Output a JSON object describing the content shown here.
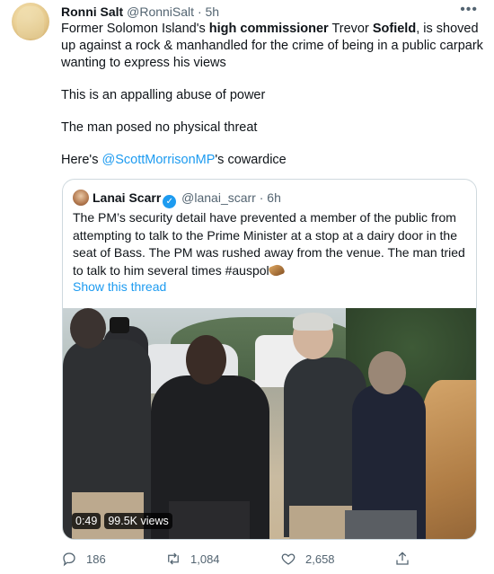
{
  "tweet": {
    "author_name": "Ronni Salt",
    "author_handle": "@RonniSalt",
    "separator": "·",
    "time": "5h",
    "more_label": "•••",
    "body": {
      "p1_a": "Former Solomon Island's ",
      "p1_b": "high commissioner",
      "p1_c": " Trevor ",
      "p1_d": "Sofield",
      "p1_e": ", is shoved up against a rock & manhandled for the crime of being in a public carpark wanting to express his views",
      "p2": "This is an appalling abuse of power",
      "p3": "The man posed no physical threat",
      "p4_a": "Here's ",
      "p4_mention": "@ScottMorrisonMP",
      "p4_b": "'s cowardice"
    }
  },
  "quote": {
    "author_name": "Lanai Scarr",
    "verified_glyph": "✓",
    "author_handle": "@lanai_scarr",
    "separator": "·",
    "time": "6h",
    "text": "The PM’s security detail have prevented a member of the public from attempting to talk to the Prime Minister at a stop at a dairy door in the seat of Bass. The PM was rushed away from the venue. The man tried to talk to him several times #auspol",
    "show_thread": "Show this thread",
    "video": {
      "duration": "0:49",
      "views": "99.5K views"
    }
  },
  "actions": {
    "replies": "186",
    "retweets": "1,084",
    "likes": "2,658"
  },
  "icons": {
    "reply": "reply-icon",
    "retweet": "retweet-icon",
    "like": "heart-icon",
    "share": "share-icon"
  },
  "colors": {
    "link": "#1d9bf0",
    "muted": "#536471",
    "text": "#0f1419",
    "border": "#cfd9de"
  }
}
